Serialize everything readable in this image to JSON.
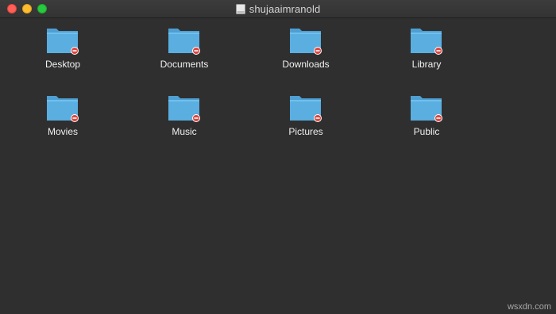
{
  "window": {
    "title": "shujaaimranold",
    "title_icon": "drive-icon"
  },
  "folders": [
    {
      "label": "Desktop",
      "icon": "folder-restricted-icon"
    },
    {
      "label": "Documents",
      "icon": "folder-restricted-icon"
    },
    {
      "label": "Downloads",
      "icon": "folder-restricted-icon"
    },
    {
      "label": "Library",
      "icon": "folder-restricted-icon"
    },
    {
      "label": "Movies",
      "icon": "folder-restricted-icon"
    },
    {
      "label": "Music",
      "icon": "folder-restricted-icon"
    },
    {
      "label": "Pictures",
      "icon": "folder-restricted-icon"
    },
    {
      "label": "Public",
      "icon": "folder-restricted-icon"
    }
  ],
  "watermark": "wsxdn.com",
  "colors": {
    "background": "#2f2f2f",
    "folder": "#5aaee0",
    "badge": "#e0443e"
  }
}
